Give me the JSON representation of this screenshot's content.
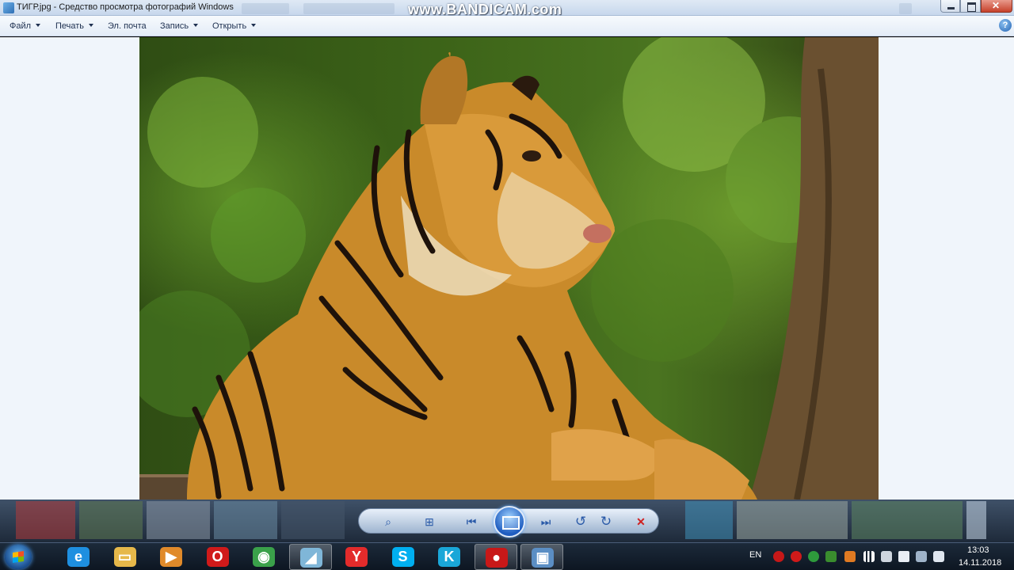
{
  "window": {
    "title": "ТИГР.jpg - Средство просмотра фотографий Windows",
    "watermark": "www.BANDICAM.com"
  },
  "menu": {
    "items": [
      {
        "label": "Файл"
      },
      {
        "label": "Печать"
      },
      {
        "label": "Эл. почта"
      },
      {
        "label": "Запись"
      },
      {
        "label": "Открыть"
      }
    ],
    "help_symbol": "?"
  },
  "controls": {
    "zoom_symbol": "⌕",
    "fit_symbol": "⊞",
    "prev_symbol": "⏮",
    "next_symbol": "⏭",
    "rotate_ccw_symbol": "↺",
    "rotate_cw_symbol": "↻",
    "delete_symbol": "✕"
  },
  "taskbar": {
    "apps": [
      {
        "name": "internet-explorer",
        "glyph": "e",
        "color": "#1e8fe0"
      },
      {
        "name": "file-explorer",
        "glyph": "▭",
        "color": "#e6b84a"
      },
      {
        "name": "media-player",
        "glyph": "▶",
        "color": "#e08a2a"
      },
      {
        "name": "opera",
        "glyph": "O",
        "color": "#d01a1a"
      },
      {
        "name": "chrome",
        "glyph": "◉",
        "color": "#3aa14a"
      },
      {
        "name": "unknown-app",
        "glyph": "◢",
        "color": "#7fb6d8"
      },
      {
        "name": "yandex-browser",
        "glyph": "Y",
        "color": "#e32b2b"
      },
      {
        "name": "skype",
        "glyph": "S",
        "color": "#00aff0"
      },
      {
        "name": "kmplayer",
        "glyph": "K",
        "color": "#1aa7d8"
      },
      {
        "name": "bandicam",
        "glyph": "●",
        "color": "#c81818"
      },
      {
        "name": "photo-viewer",
        "glyph": "▣",
        "color": "#5b8ec4"
      }
    ],
    "language": "EN",
    "time": "13:03",
    "date": "14.11.2018"
  }
}
